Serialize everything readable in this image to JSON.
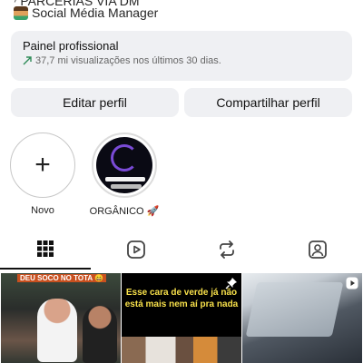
{
  "profile": {
    "bio_top": "⁾ PARCERIAS VIA DM",
    "bio_role": "Social Média Manager"
  },
  "dashboard": {
    "title": "Painel profissional",
    "subtitle": "37,7 mi visualizações nos últimos 30 dias."
  },
  "actions": {
    "edit_label": "Editar perfil",
    "share_label": "Compartilhar perfil"
  },
  "highlights": [
    {
      "label": "Novo"
    },
    {
      "label": "ORGÂNICO 🚀"
    }
  ],
  "tabs": [
    "grid",
    "reels",
    "reposts",
    "tagged"
  ],
  "posts": [
    {
      "caption": "DEU SOCO NO TOTA 😄",
      "type": "video"
    },
    {
      "caption": "Esse cara de verde já não está mais nem aí pra nada",
      "type": "pinned"
    },
    {
      "caption": "",
      "type": "video"
    }
  ],
  "colors": {
    "card_bg": "#eff0f3",
    "trend_green": "#2e8b57",
    "caption_yellow": "#f7e04a"
  }
}
